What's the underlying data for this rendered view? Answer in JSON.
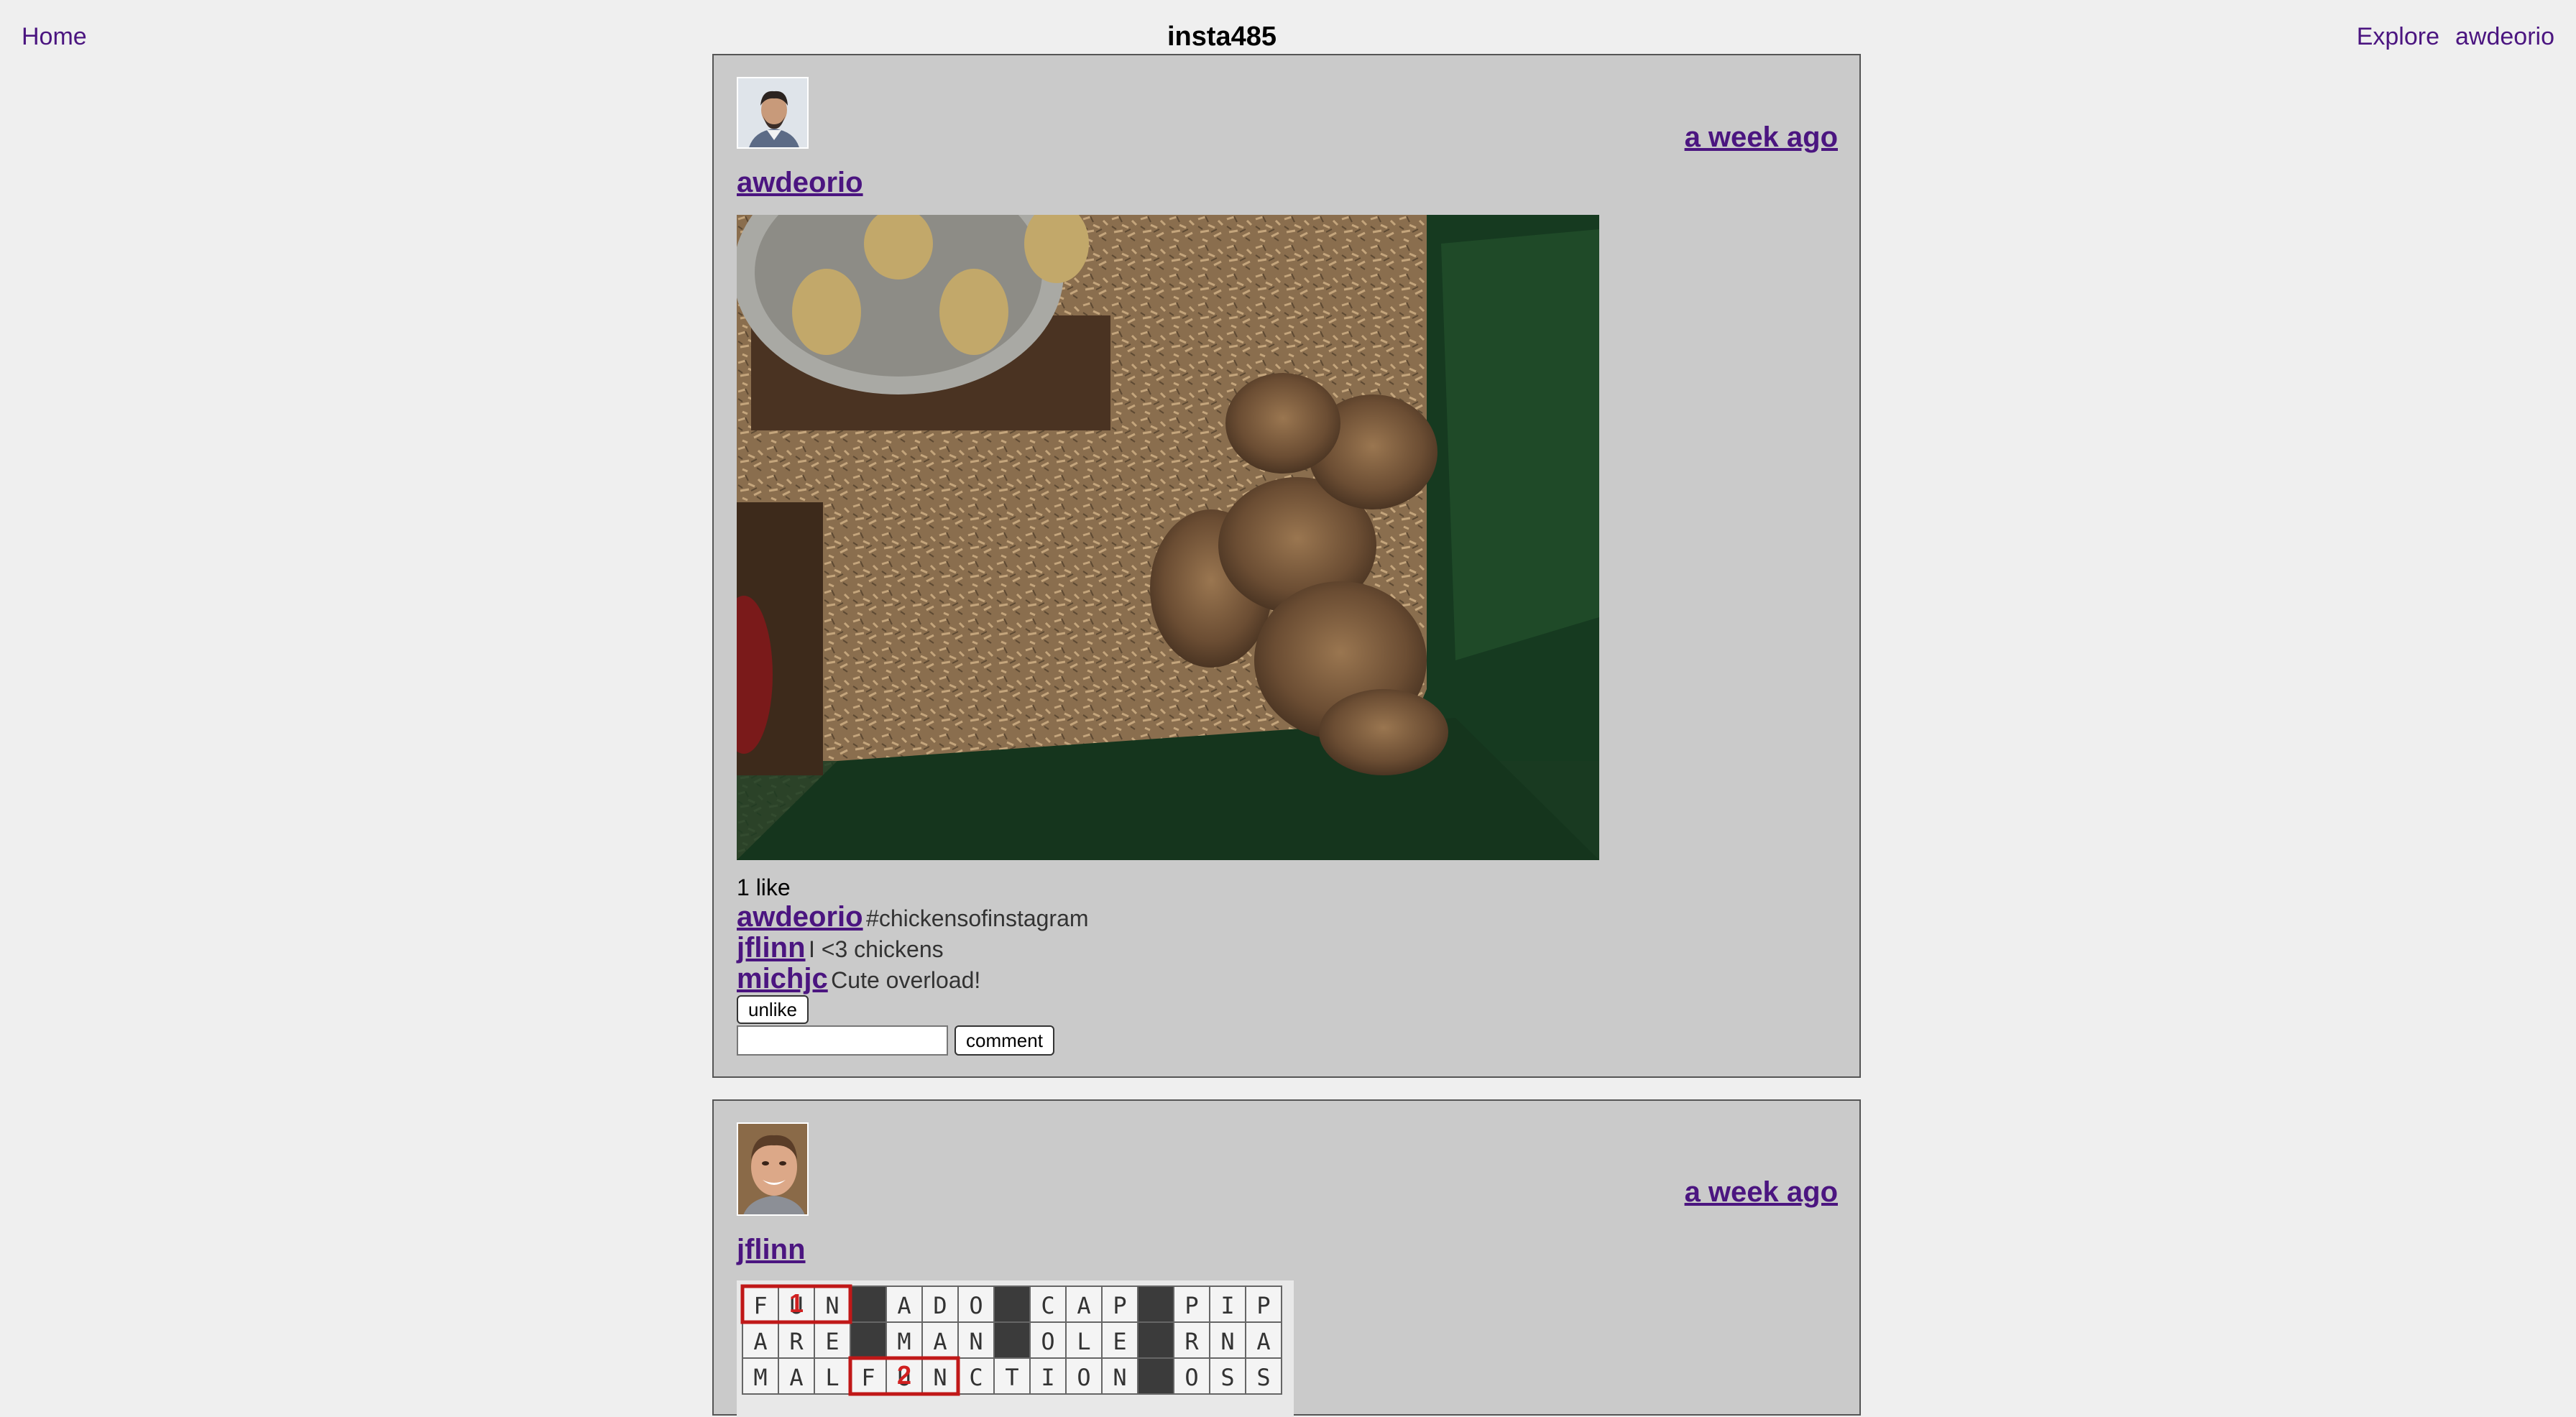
{
  "nav": {
    "home": "Home",
    "title": "insta485",
    "explore": "Explore",
    "user": "awdeorio"
  },
  "posts": [
    {
      "owner": "awdeorio",
      "timestamp": "a week ago",
      "avatar_icon": "man-portrait-avatar",
      "image_subject": "chicks-in-brooder-photo",
      "likes": "1 like",
      "comments": [
        {
          "owner": "awdeorio",
          "text": "#chickensofinstagram"
        },
        {
          "owner": "jflinn",
          "text": "I <3 chickens"
        },
        {
          "owner": "michjc",
          "text": "Cute overload!"
        }
      ],
      "like_button": "unlike",
      "comment_button": "comment",
      "comment_placeholder": ""
    },
    {
      "owner": "jflinn",
      "timestamp": "a week ago",
      "avatar_icon": "smiling-man-avatar",
      "image_subject": "crossword-grid-photo",
      "crossword_rows": [
        [
          "F",
          "U",
          "N",
          "",
          "A",
          "D",
          "O",
          "",
          "C",
          "A",
          "P",
          "",
          "P",
          "I",
          "P"
        ],
        [
          "A",
          "R",
          "E",
          "",
          "M",
          "A",
          "N",
          "",
          "O",
          "L",
          "E",
          "",
          "R",
          "N",
          "A"
        ],
        [
          "M",
          "A",
          "L",
          "F",
          "U",
          "N",
          "C",
          "T",
          "I",
          "O",
          "N",
          "",
          "O",
          "S",
          "S"
        ]
      ],
      "crossword_marks": [
        "1",
        "2"
      ]
    }
  ],
  "colors": {
    "page_bg": "#efefef",
    "card_bg": "#cacaca",
    "link": "#4b1580"
  }
}
